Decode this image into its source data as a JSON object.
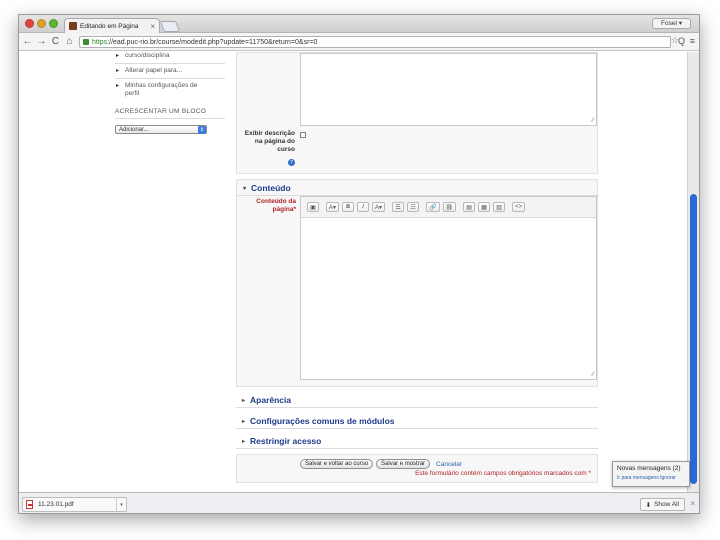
{
  "browser": {
    "tab_title": "Editando em Página",
    "tab_close": "×",
    "profile": "Fosel ▾",
    "url_scheme": "https",
    "url_rest": "://ead.puc-rio.br/course/modedit.php?update=11750&return=0&sr=0",
    "nav_back": "←",
    "nav_forward": "→",
    "nav_reload": "C",
    "nav_home": "⌂",
    "star": "☆",
    "zoom": "Q",
    "menu": "≡"
  },
  "sidebar": {
    "items": [
      {
        "label": "curso/disciplina"
      },
      {
        "label": "Alterar papel para..."
      },
      {
        "label": "Minhas configurações de perfil"
      }
    ],
    "add_block_title": "ACRESCENTAR UM BLOCO",
    "add_block_select": "Adicionar...",
    "select_arrow": "⇕"
  },
  "form": {
    "show_description_label": "Exibir descrição na página do curso",
    "help_glyph": "?",
    "content_section": "Conteúdo",
    "content_label": "Conteúdo da página*",
    "toolbar_buttons": [
      "▣",
      "A▾",
      "B",
      "I",
      "A▾",
      "☰",
      "☷",
      "🔗",
      "⛓",
      "▤",
      "▦",
      "▥",
      "<>"
    ],
    "sections": [
      {
        "label": "Aparência"
      },
      {
        "label": "Configurações comuns de módulos"
      },
      {
        "label": "Restringir acesso"
      }
    ],
    "save_return_button": "Salvar e voltar ao curso",
    "save_show_button": "Salvar e mostrar",
    "cancel_link": "Cancelar",
    "required_note": "Este formulário contém campos obrigatórios marcados com *"
  },
  "notification": {
    "title": "Novas mensagens (2)",
    "actions": "Ir para mensagens   Ignorar"
  },
  "downloads": {
    "file_name": "11.23.01.pdf",
    "caret": "▾",
    "show_all": "Show All",
    "show_all_icon": "⬇",
    "close": "×"
  }
}
